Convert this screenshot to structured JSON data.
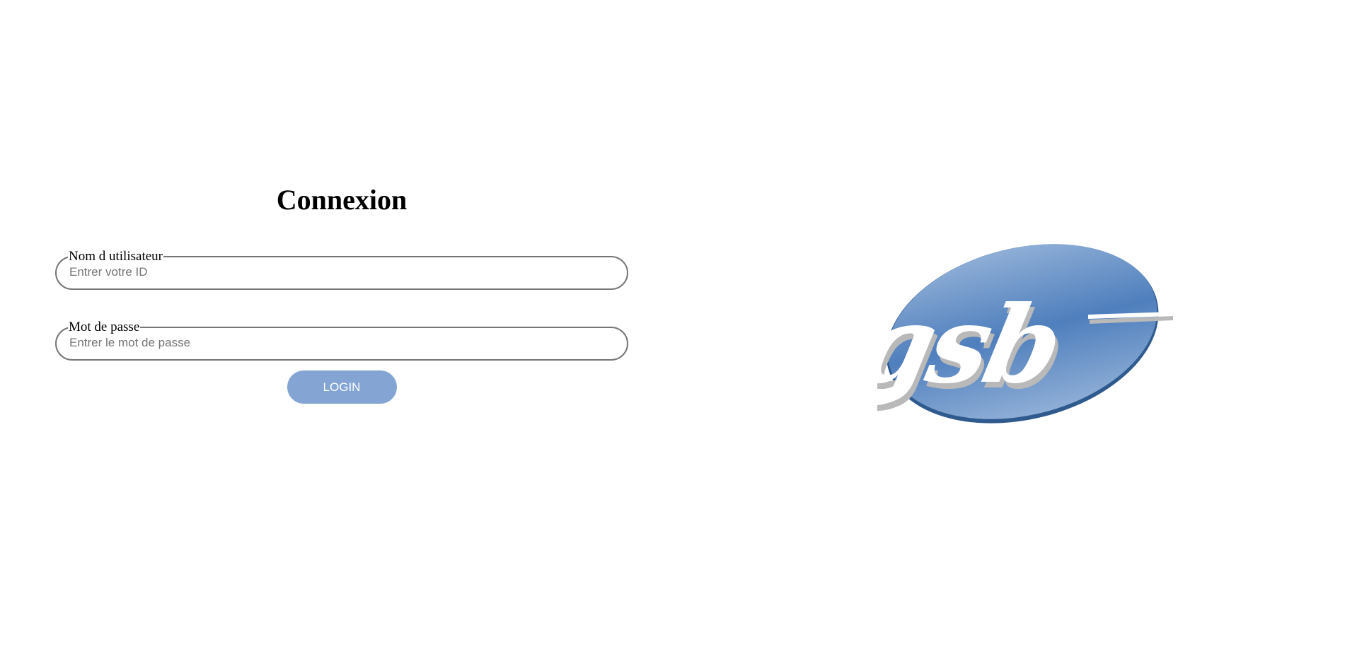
{
  "page": {
    "heading": "Connexion"
  },
  "form": {
    "username": {
      "label": "Nom d utilisateur",
      "placeholder": "Entrer votre ID",
      "value": ""
    },
    "password": {
      "label": "Mot de passe",
      "placeholder": "Entrer le mot de passe",
      "value": ""
    },
    "login_label": "LOGIN"
  },
  "logo": {
    "text": "gsb",
    "icon": "gsb-logo",
    "colors": {
      "ellipse_top": "#8eaed6",
      "ellipse_mid": "#4f7fbd",
      "ellipse_edge": "#2f5a8e",
      "letters": "#ffffff",
      "letter_shadow": "#b9b9b9"
    }
  },
  "colors": {
    "button_bg": "#84a5d3",
    "button_text": "#ffffff",
    "field_border": "#767676"
  }
}
